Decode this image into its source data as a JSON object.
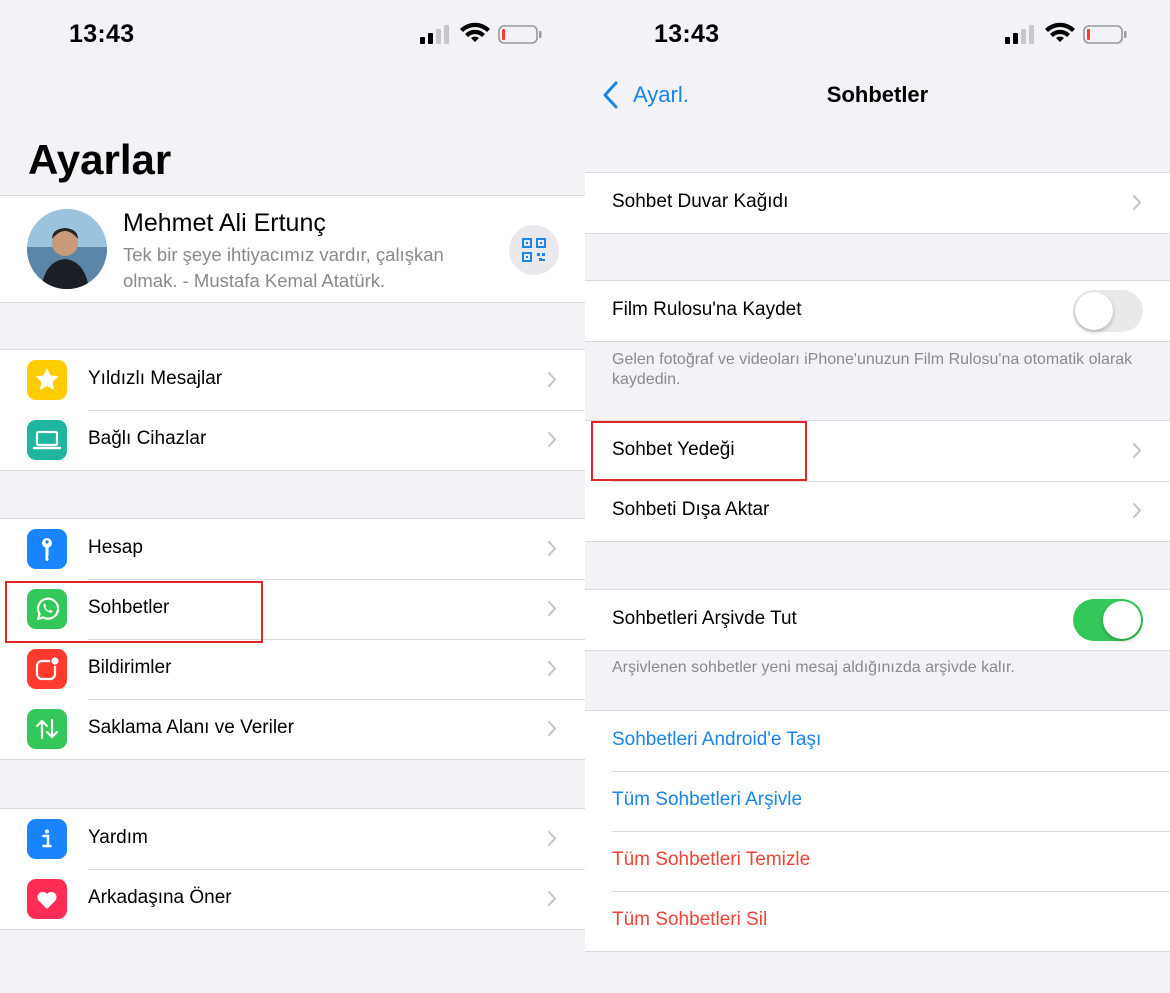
{
  "status_bar": {
    "time_left": "13:43",
    "time_right": "13:43"
  },
  "left": {
    "title": "Ayarlar",
    "profile": {
      "name": "Mehmet Ali Ertunç",
      "status": "Tek bir şeye ihtiyacımız vardır, çalışkan olmak. - Mustafa Kemal Atatürk."
    },
    "groups": [
      [
        {
          "label": "Yıldızlı Mesajlar",
          "icon": "star-icon",
          "color": "#ffcc00"
        },
        {
          "label": "Bağlı Cihazlar",
          "icon": "laptop-icon",
          "color": "#1fb59f"
        }
      ],
      [
        {
          "label": "Hesap",
          "icon": "key-icon",
          "color": "#1a84ff"
        },
        {
          "label": "Sohbetler",
          "icon": "whatsapp-icon",
          "color": "#34c759"
        },
        {
          "label": "Bildirimler",
          "icon": "notification-icon",
          "color": "#ff3b30"
        },
        {
          "label": "Saklama Alanı ve Veriler",
          "icon": "data-transfer-icon",
          "color": "#34c759"
        }
      ],
      [
        {
          "label": "Yardım",
          "icon": "info-icon",
          "color": "#1a84ff"
        },
        {
          "label": "Arkadaşına Öner",
          "icon": "heart-icon",
          "color": "#ff2d55"
        }
      ]
    ]
  },
  "right": {
    "back_label": "Ayarl.",
    "title": "Sohbetler",
    "wallpaper": "Sohbet Duvar Kağıdı",
    "save_to_camera_roll": {
      "label": "Film Rulosu'na Kaydet",
      "enabled": false
    },
    "save_note": "Gelen fotoğraf ve videoları iPhone'unuzun Film Rulosu'na otomatik olarak kaydedin.",
    "backup": "Sohbet Yedeği",
    "export": "Sohbeti Dışa Aktar",
    "keep_archived": {
      "label": "Sohbetleri Arşivde Tut",
      "enabled": true
    },
    "archive_note": "Arşivlenen sohbetler yeni mesaj aldığınızda arşivde kalır.",
    "actions": [
      {
        "label": "Sohbetleri Android'e Taşı",
        "color": "#1a84e8"
      },
      {
        "label": "Tüm Sohbetleri Arşivle",
        "color": "#1a84e8"
      },
      {
        "label": "Tüm Sohbetleri Temizle",
        "color": "#f0443a"
      },
      {
        "label": "Tüm Sohbetleri Sil",
        "color": "#f0443a"
      }
    ]
  },
  "colors": {
    "accent": "#1a84e8",
    "destructive": "#f0443a",
    "highlight": "#e0262b",
    "toggle_on": "#34c759"
  }
}
